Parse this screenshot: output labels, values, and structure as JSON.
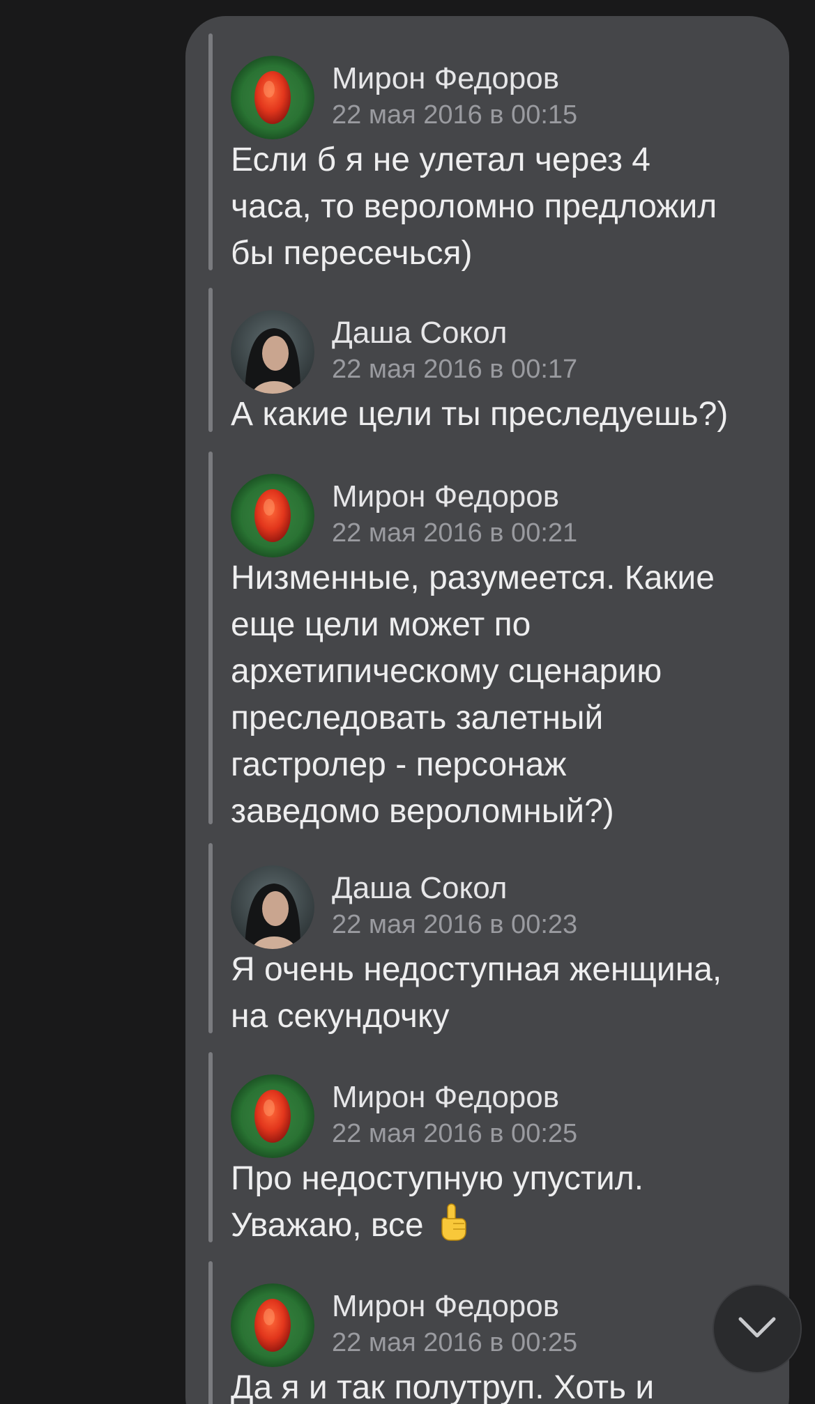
{
  "colors": {
    "background": "#19191a",
    "bubble": "#454649",
    "quote_bar": "#7a7b7f",
    "name": "#e6e6e8",
    "date": "#9a9ba0",
    "text": "#eeeeef"
  },
  "messages": [
    {
      "author": "Мирон Федоров",
      "avatar": "red-seed-avatar",
      "date": "22 мая 2016 в 00:15",
      "lines": [
        "Если б я не улетал через 4",
        "часа, то вероломно предложил",
        "бы пересечься)"
      ]
    },
    {
      "author": "Даша Сокол",
      "avatar": "woman-portrait-avatar",
      "date": "22 мая 2016 в 00:17",
      "lines": [
        "А какие цели ты преследуешь?)"
      ]
    },
    {
      "author": "Мирон Федоров",
      "avatar": "red-seed-avatar",
      "date": "22 мая 2016 в 00:21",
      "lines": [
        "Низменные, разумеется. Какие",
        "еще цели может по",
        "архетипическому сценарию",
        "преследовать залетный",
        "гастролер - персонаж",
        "заведомо вероломный?)"
      ]
    },
    {
      "author": "Даша Сокол",
      "avatar": "woman-portrait-avatar",
      "date": "22 мая 2016 в 00:23",
      "lines": [
        "Я очень недоступная женщина,",
        "на секундочку"
      ]
    },
    {
      "author": "Мирон Федоров",
      "avatar": "red-seed-avatar",
      "date": "22 мая 2016 в 00:25",
      "lines": [
        "Про недоступную упустил.",
        "Уважаю, все"
      ],
      "emoji": "pointing-up-hand-icon"
    },
    {
      "author": "Мирон Федоров",
      "avatar": "red-seed-avatar",
      "date": "22 мая 2016 в 00:25",
      "lines": [
        "Да я и так полутруп. Хоть и"
      ]
    }
  ],
  "scroll_button": {
    "icon": "chevron-down-icon"
  }
}
